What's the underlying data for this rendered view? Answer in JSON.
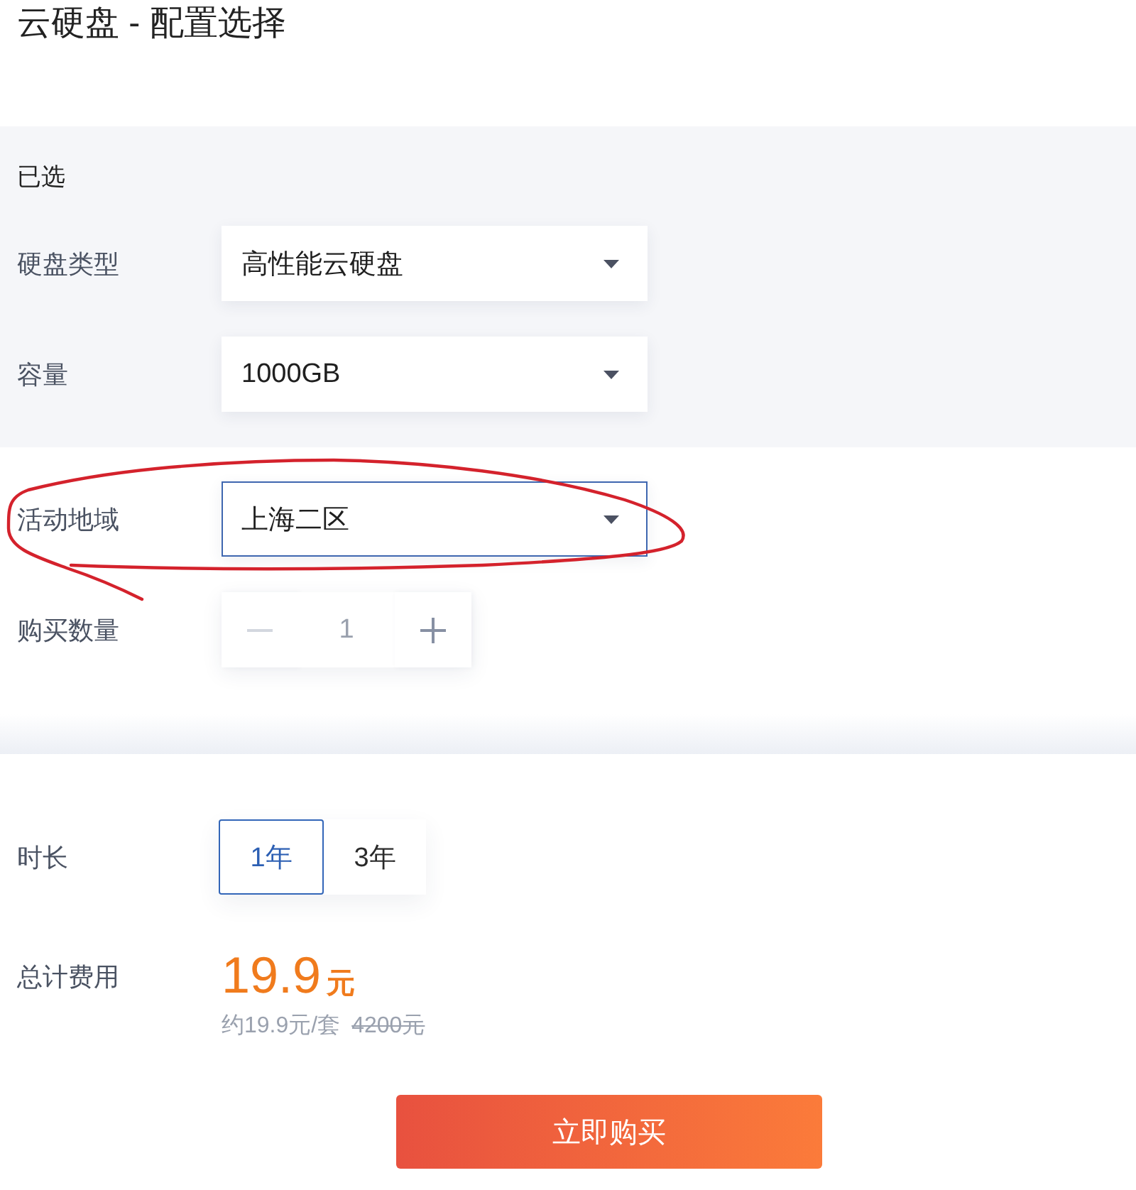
{
  "page": {
    "title": "云硬盘 - 配置选择"
  },
  "selected_config": {
    "heading": "已选",
    "fields": [
      {
        "label": "硬盘类型",
        "value": "高性能云硬盘",
        "focused": false
      },
      {
        "label": "容量",
        "value": "1000GB",
        "focused": false
      }
    ]
  },
  "region": {
    "label": "活动地域",
    "value": "上海二区",
    "focused": true
  },
  "quantity": {
    "label": "购买数量",
    "value": "1",
    "buttons": [
      {
        "kind": "decrement",
        "disabled": true
      },
      {
        "kind": "increment",
        "disabled": false
      }
    ]
  },
  "duration": {
    "label": "时长",
    "options": [
      {
        "label": "1年",
        "selected": true
      },
      {
        "label": "3年",
        "selected": false
      }
    ]
  },
  "total": {
    "label": "总计费用",
    "amount": "19.9",
    "unit": "元",
    "unit_price": "约19.9元/套",
    "original_price": "4200元"
  },
  "buy_button": {
    "label": "立即购买"
  }
}
